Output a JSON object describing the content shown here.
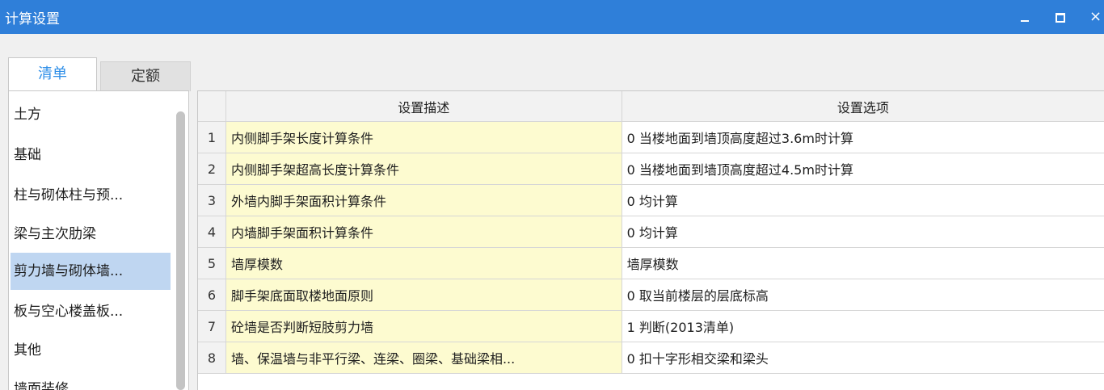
{
  "window": {
    "title": "计算设置",
    "minimize_symbol": "",
    "maximize_symbol": "",
    "close_symbol": "×"
  },
  "tabs": [
    {
      "label": "清单",
      "active": true
    },
    {
      "label": "定额",
      "active": false
    }
  ],
  "categories": [
    {
      "label": "土方",
      "selected": false
    },
    {
      "label": "基础",
      "selected": false
    },
    {
      "label": "柱与砌体柱与预...",
      "selected": false
    },
    {
      "label": "梁与主次肋梁",
      "selected": false
    },
    {
      "label": "剪力墙与砌体墙...",
      "selected": true
    },
    {
      "label": "板与空心楼盖板...",
      "selected": false
    },
    {
      "label": "其他",
      "selected": false
    },
    {
      "label": "墙面装修",
      "selected": false
    }
  ],
  "table": {
    "headers": {
      "num": "",
      "description": "设置描述",
      "option": "设置选项"
    },
    "rows": [
      {
        "num": "1",
        "description": "内侧脚手架长度计算条件",
        "option": "0 当楼地面到墙顶高度超过3.6m时计算"
      },
      {
        "num": "2",
        "description": "内侧脚手架超高长度计算条件",
        "option": "0 当楼地面到墙顶高度超过4.5m时计算"
      },
      {
        "num": "3",
        "description": "外墙内脚手架面积计算条件",
        "option": "0 均计算"
      },
      {
        "num": "4",
        "description": "内墙脚手架面积计算条件",
        "option": "0 均计算"
      },
      {
        "num": "5",
        "description": "墙厚模数",
        "option": "墙厚模数"
      },
      {
        "num": "6",
        "description": "脚手架底面取楼地面原则",
        "option": "0 取当前楼层的层底标高"
      },
      {
        "num": "7",
        "description": "砼墙是否判断短肢剪力墙",
        "option": "1 判断(2013清单)"
      },
      {
        "num": "8",
        "description": "墙、保温墙与非平行梁、连梁、圈梁、基础梁相...",
        "option": "0 扣十字形相交梁和梁头"
      }
    ]
  },
  "colors": {
    "titlebar": "#2f7fd9",
    "active_tab_text": "#2e8ee8",
    "selected_item": "#bfd6f1",
    "description_cell": "#fdfbd0"
  }
}
